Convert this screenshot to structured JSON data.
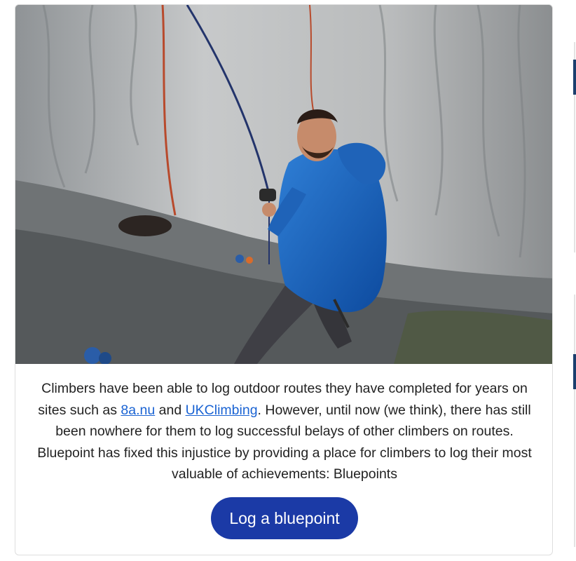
{
  "hero_image": {
    "alt": "",
    "icon": "climber-photo"
  },
  "intro": {
    "text_before_link1": "Climbers have been able to log outdoor routes they have completed for years on sites such as ",
    "link1": "8a.nu",
    "text_between_links": " and ",
    "link2": "UKClimbing",
    "text_after_links": ". However, until now (we think), there has still been nowhere for them to log successful belays of other climbers on routes. Bluepoint has fixed this injustice by providing a place for climbers to log their most valuable of achievements: Bluepoints"
  },
  "cta": {
    "label": "Log a bluepoint"
  },
  "colors": {
    "accent": "#1b3aa6",
    "link": "#1a63d3",
    "text": "#222222"
  }
}
